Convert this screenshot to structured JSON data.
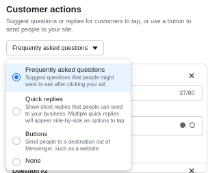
{
  "section": {
    "title": "Customer actions",
    "description": "Suggest questions or replies for customers to tap, or use a button to send people to your site."
  },
  "dropdown": {
    "selected_label": "Frequently asked questions"
  },
  "menu": {
    "items": [
      {
        "label": "Frequently asked questions",
        "description": "Suggest questions that people might want to ask after clicking your ad.",
        "selected": true
      },
      {
        "label": "Quick replies",
        "description": "Show short replies that people can send to your business. Multiple quick replies will appear side-by-side as options to tap.",
        "selected": false
      },
      {
        "label": "Buttons",
        "description": "Send people to a destination out of Messenger, such as a website.",
        "selected": false
      },
      {
        "label": "None",
        "description": "",
        "selected": false
      }
    ]
  },
  "background": {
    "char_counter": "37/80",
    "question2_label": "Question #2",
    "close_glyph": "✕"
  }
}
